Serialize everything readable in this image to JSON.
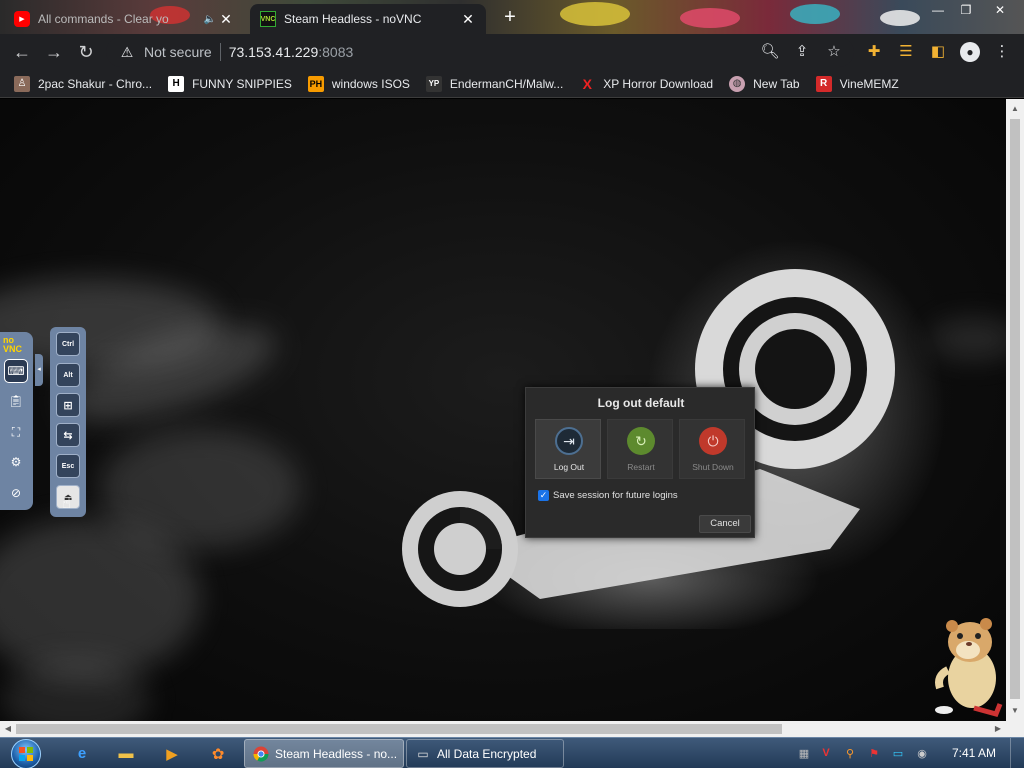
{
  "browser": {
    "tabs": [
      {
        "title": "All commands - Clear yo",
        "favicon": "youtube-icon",
        "state": "inactive"
      },
      {
        "title": "Steam Headless - noVNC",
        "favicon": "vnc-icon",
        "state": "active"
      }
    ],
    "address": {
      "security_label": "Not secure",
      "host": "73.153.41.229",
      "port": ":8083"
    },
    "bookmarks": [
      {
        "label": "2pac Shakur - Chro...",
        "icon": "2pac-icon"
      },
      {
        "label": "FUNNY SNIPPIES",
        "icon": "H"
      },
      {
        "label": "windows ISOS",
        "icon": "PH"
      },
      {
        "label": "EndermanCH/Malw...",
        "icon": "YP"
      },
      {
        "label": "XP Horror Download",
        "icon": "X"
      },
      {
        "label": "New Tab",
        "icon": "globe-icon"
      },
      {
        "label": "VineMEMZ",
        "icon": "R"
      }
    ]
  },
  "novnc": {
    "logo_top": "no",
    "logo_bottom": "VNC",
    "extra_keys": [
      "Ctrl",
      "Alt",
      "Win",
      "Tab",
      "Esc",
      "Ctrl+Alt+Del"
    ],
    "key_labels": {
      "ctrl": "Ctrl",
      "alt": "Alt",
      "esc": "Esc"
    }
  },
  "dialog": {
    "title": "Log out default",
    "actions": [
      {
        "label": "Log Out",
        "icon": "logout-icon",
        "enabled": true,
        "color": "#4d6f91"
      },
      {
        "label": "Restart",
        "icon": "restart-icon",
        "enabled": false,
        "color": "#5d8a2e"
      },
      {
        "label": "Shut Down",
        "icon": "power-icon",
        "enabled": false,
        "color": "#c0392b"
      }
    ],
    "save_session": {
      "label": "Save session for future logins",
      "checked": true
    },
    "cancel_label": "Cancel"
  },
  "taskbar": {
    "tasks": [
      {
        "label": "Steam Headless - no...",
        "icon": "chrome-icon",
        "active": true
      },
      {
        "label": "All Data Encrypted",
        "icon": "window-icon",
        "active": false
      }
    ],
    "clock": "7:41 AM"
  },
  "colors": {
    "novnc_panel": "#6e84a3",
    "dialog_bg": "#2a2a2a",
    "chrome_bg": "#202124"
  }
}
